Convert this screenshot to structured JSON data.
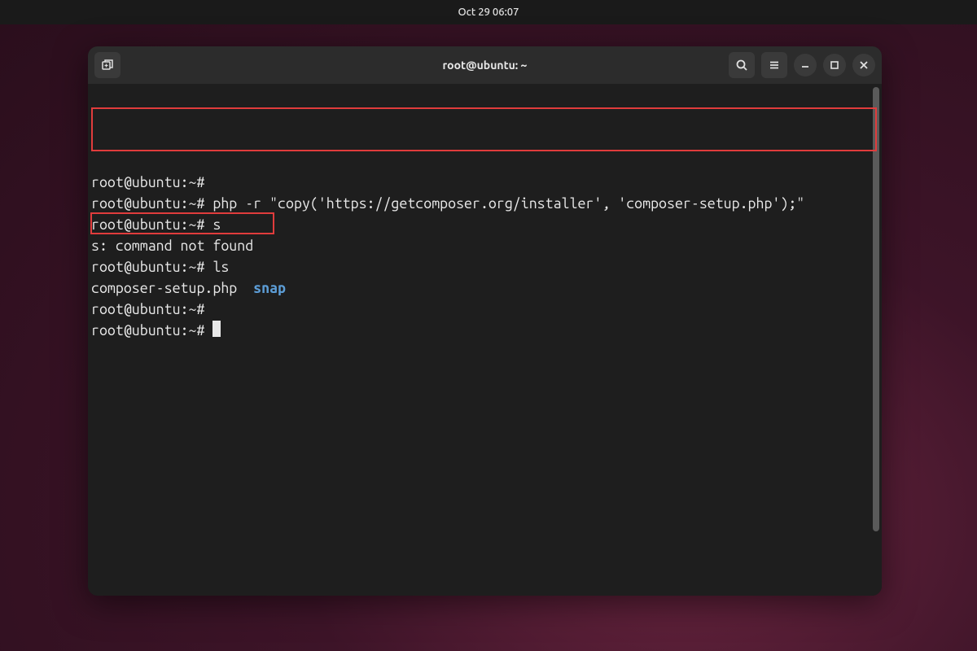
{
  "topbar": {
    "datetime": "Oct 29  06:07"
  },
  "window": {
    "title": "root@ubuntu: ~"
  },
  "terminal": {
    "prompt": "root@ubuntu:~#",
    "lines": {
      "l1": "root@ubuntu:~#",
      "l2": "root@ubuntu:~# php -r \"copy('https://getcomposer.org/installer', 'composer-setup.php');\"",
      "l3": "root@ubuntu:~# s",
      "l4": "s: command not found",
      "l5": "root@ubuntu:~# ls",
      "l6_file": "composer-setup.php",
      "l6_dir": "snap",
      "l7": "root@ubuntu:~#",
      "l8": "root@ubuntu:~# "
    }
  },
  "icons": {
    "newtab": "new-tab-icon",
    "search": "search-icon",
    "menu": "hamburger-icon",
    "minimize": "minimize-icon",
    "maximize": "maximize-icon",
    "close": "close-icon"
  }
}
